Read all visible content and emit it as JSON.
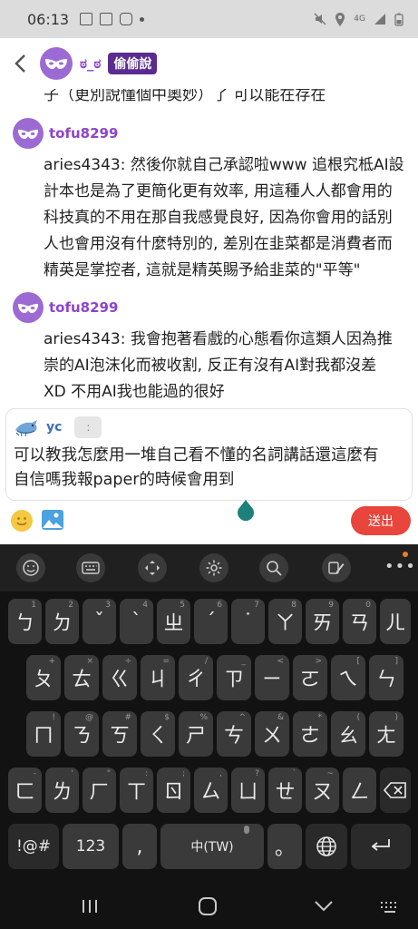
{
  "status_bar": {
    "time": "06:13",
    "network": "4G"
  },
  "header": {
    "name": "ಠ_ಠ",
    "badge": "偷偷說"
  },
  "chat": {
    "cut_line": "子（更別說懂個中奧妙）了 可以能在存在",
    "messages": [
      {
        "user": "tofu8299",
        "lines": [
          "aries4343: 然後你就自己承認啦www 追根究柢AI設",
          "計本也是為了更簡化更有效率, 用這種人人都會用的",
          "科技真的不用在那自我感覺良好, 因為你會用的話別",
          "人也會用沒有什麼特別的, 差別在韭菜都是消費者而",
          "精英是掌控者, 這就是精英賜予給韭菜的\"平等\""
        ]
      },
      {
        "user": "tofu8299",
        "lines": [
          "aries4343: 我會抱著看戲的心態看你這類人因為推",
          "崇的AI泡沫化而被收割, 反正有沒有AI對我都沒差",
          "XD 不用AI我也能過的很好"
        ]
      }
    ]
  },
  "composer": {
    "name": "yc",
    "chip": ":",
    "lines": [
      "可以教我怎麼用一堆自己看不懂的名詞講話還這麼有",
      "自信嗎我報paper的時候會用到"
    ]
  },
  "send_label": "送出",
  "keyboard": {
    "row1": [
      {
        "label": "ㄅ",
        "hint": "1"
      },
      {
        "label": "ㄉ",
        "hint": "2"
      },
      {
        "label": "ˇ",
        "hint": "3"
      },
      {
        "label": "ˋ",
        "hint": "4"
      },
      {
        "label": "ㄓ",
        "hint": "5"
      },
      {
        "label": "ˊ",
        "hint": "6"
      },
      {
        "label": "˙",
        "hint": "7"
      },
      {
        "label": "ㄚ",
        "hint": "8"
      },
      {
        "label": "ㄞ",
        "hint": "9"
      },
      {
        "label": "ㄢ",
        "hint": "0"
      },
      {
        "label": "ㄦ",
        "hint": ""
      }
    ],
    "row2": [
      {
        "label": "ㄆ",
        "hint": "+"
      },
      {
        "label": "ㄊ",
        "hint": "×"
      },
      {
        "label": "ㄍ",
        "hint": "÷"
      },
      {
        "label": "ㄐ",
        "hint": "="
      },
      {
        "label": "ㄔ",
        "hint": "/"
      },
      {
        "label": "ㄗ",
        "hint": "_"
      },
      {
        "label": "ㄧ",
        "hint": "<"
      },
      {
        "label": "ㄛ",
        "hint": ">"
      },
      {
        "label": "ㄟ",
        "hint": "["
      },
      {
        "label": "ㄣ",
        "hint": "]"
      }
    ],
    "row3": [
      {
        "label": "ㄇ",
        "hint": "!"
      },
      {
        "label": "ㄋ",
        "hint": "@"
      },
      {
        "label": "ㄎ",
        "hint": "#"
      },
      {
        "label": "ㄑ",
        "hint": "$"
      },
      {
        "label": "ㄕ",
        "hint": "%"
      },
      {
        "label": "ㄘ",
        "hint": "^"
      },
      {
        "label": "ㄨ",
        "hint": "&"
      },
      {
        "label": "ㄜ",
        "hint": "*"
      },
      {
        "label": "ㄠ",
        "hint": "("
      },
      {
        "label": "ㄤ",
        "hint": ")"
      }
    ],
    "row4": [
      {
        "label": "ㄈ",
        "hint": "-"
      },
      {
        "label": "ㄌ",
        "hint": "'"
      },
      {
        "label": "ㄏ",
        "hint": "\""
      },
      {
        "label": "ㄒ",
        "hint": ":"
      },
      {
        "label": "ㄖ",
        "hint": ";"
      },
      {
        "label": "ㄙ",
        "hint": ","
      },
      {
        "label": "ㄩ",
        "hint": "?"
      },
      {
        "label": "ㄝ",
        "hint": "`"
      },
      {
        "label": "ㄡ",
        "hint": "~"
      },
      {
        "label": "ㄥ",
        "hint": ""
      }
    ],
    "symbols_label": "!@#",
    "numbers_label": "123",
    "comma_label": ",",
    "space_label": "中(TW)",
    "period_label": "。"
  }
}
